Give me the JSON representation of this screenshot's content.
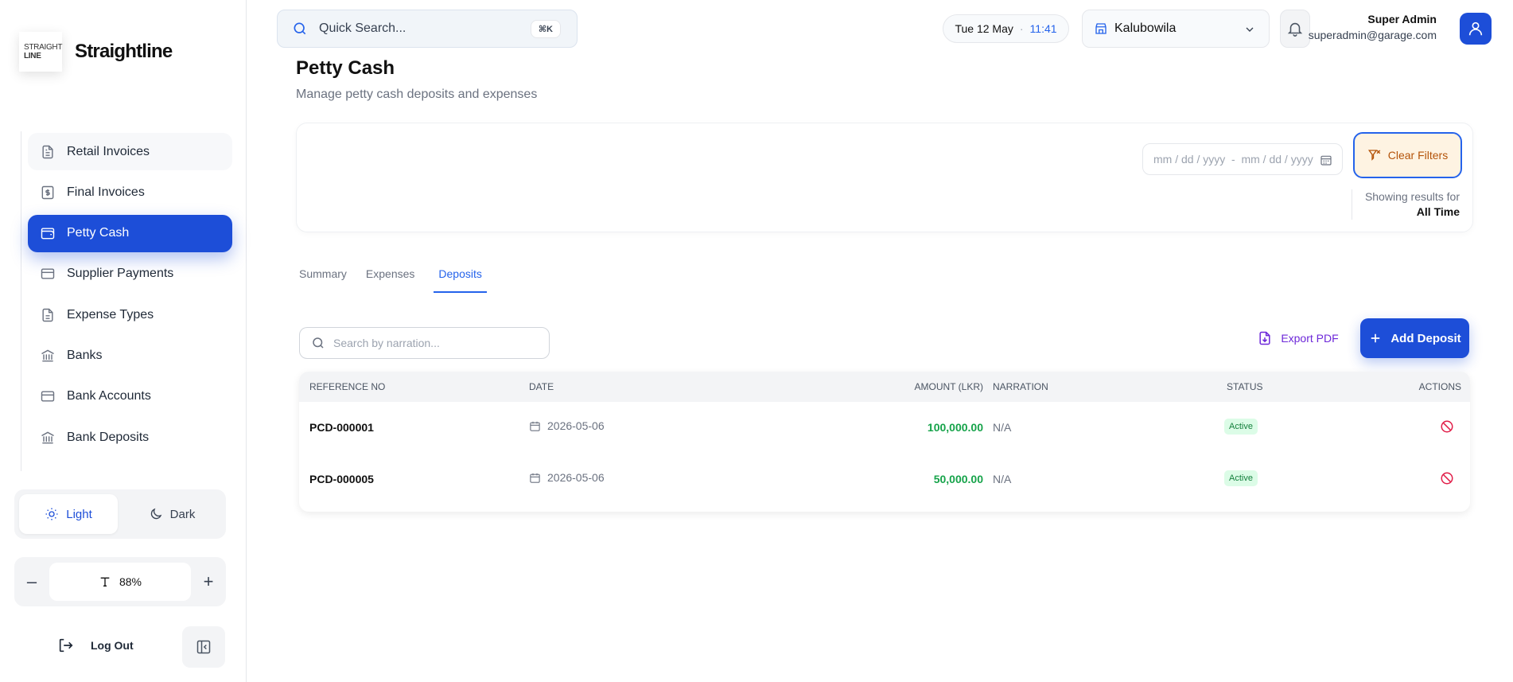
{
  "brand": {
    "logo_line1": "STRAIGHT",
    "logo_line2": "LINE",
    "name": "Straightline"
  },
  "sidebar": {
    "items": [
      {
        "label": "Retail Invoices"
      },
      {
        "label": "Final Invoices"
      },
      {
        "label": "Petty Cash"
      },
      {
        "label": "Supplier Payments"
      },
      {
        "label": "Expense Types"
      },
      {
        "label": "Banks"
      },
      {
        "label": "Bank Accounts"
      },
      {
        "label": "Bank Deposits"
      }
    ],
    "active": "Petty Cash",
    "theme": {
      "light": "Light",
      "dark": "Dark"
    },
    "zoom": {
      "minus": "–",
      "value": "88%",
      "plus": "+"
    },
    "logout": "Log Out"
  },
  "topbar": {
    "search_placeholder": "Quick Search...",
    "shortcut": "⌘K",
    "date": "Tue 12 May",
    "separator": "·",
    "time": "11:41",
    "branch": "Kalubowila",
    "user_name": "Super Admin",
    "user_email": "superadmin@garage.com"
  },
  "page": {
    "title": "Petty Cash",
    "subtitle": "Manage petty cash deposits and expenses"
  },
  "filters": {
    "date_range": "mm / dd / yyyy  -  mm / dd / yyyy",
    "clear_label": "Clear Filters",
    "showing_label": "Showing results for",
    "showing_value": "All Time"
  },
  "tabs": [
    {
      "label": "Summary"
    },
    {
      "label": "Expenses"
    },
    {
      "label": "Deposits"
    }
  ],
  "active_tab": "Deposits",
  "toolbar": {
    "search_placeholder": "Search by narration...",
    "export_label": "Export PDF",
    "add_label": "Add Deposit"
  },
  "table": {
    "headers": {
      "ref": "Reference No",
      "date": "Date",
      "amount": "Amount (LKR)",
      "narration": "Narration",
      "status": "Status",
      "actions": "Actions"
    },
    "rows": [
      {
        "ref": "PCD-000001",
        "date": "2026-05-06",
        "amount": "100,000.00",
        "narration": "N/A",
        "status": "Active"
      },
      {
        "ref": "PCD-000005",
        "date": "2026-05-06",
        "amount": "50,000.00",
        "narration": "N/A",
        "status": "Active"
      }
    ]
  },
  "colors": {
    "accent": "#1d4ed8",
    "amount": "#16a34a",
    "status_bg": "#dcfce7",
    "danger": "#e11d48",
    "clear_bg": "#fef3e2"
  }
}
